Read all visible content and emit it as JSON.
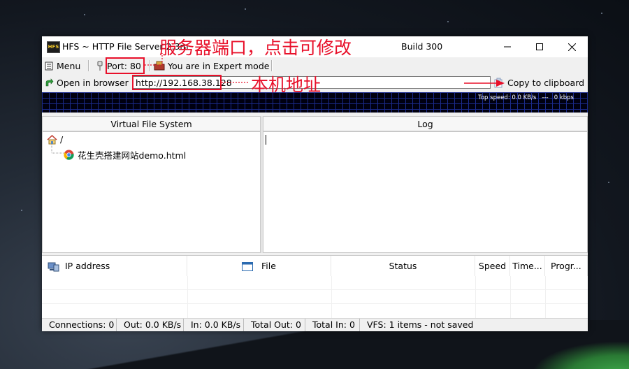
{
  "window": {
    "title": "HFS ~ HTTP File Server 2.3m",
    "build": "Build 300",
    "app_icon_text": "HFS"
  },
  "toolbar": {
    "menu_label": "Menu",
    "port_label": "Port: 80",
    "mode_label": "You are in Expert mode"
  },
  "addressbar": {
    "open_browser_label": "Open in browser",
    "url": "http://192.168.38.128",
    "copy_label": "Copy to clipboard"
  },
  "speed_graph": {
    "top_speed": "Top speed: 0.0 KB/s",
    "separator": "---",
    "current": "0 kbps"
  },
  "vfs": {
    "header": "Virtual File System",
    "root": "/",
    "items": [
      {
        "name": "花生壳搭建网站demo.html"
      }
    ]
  },
  "log": {
    "header": "Log"
  },
  "connections": {
    "columns": [
      "IP address",
      "File",
      "Status",
      "Speed",
      "Time...",
      "Progr..."
    ]
  },
  "status_bar": {
    "connections": "Connections: 0",
    "out": "Out: 0.0 KB/s",
    "in": "In: 0.0 KB/s",
    "total_out": "Total Out: 0",
    "total_in": "Total In: 0",
    "vfs": "VFS: 1 items - not saved"
  },
  "annotations": {
    "port_note": "服务器端口，点击可修改",
    "address_note": "本机地址"
  },
  "colors": {
    "annotation": "#e8102a",
    "graph_bg": "#000010",
    "graph_grid": "#1a2a8a"
  }
}
